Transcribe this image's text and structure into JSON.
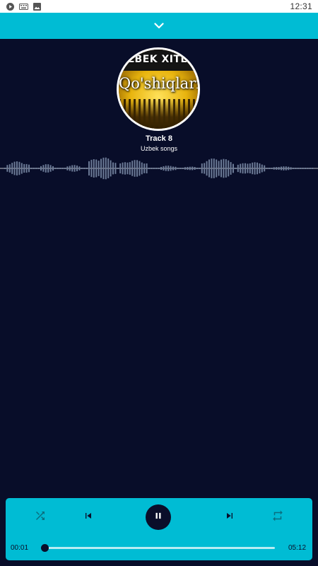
{
  "status_bar": {
    "icons": [
      "play-circle-icon",
      "keyboard-icon",
      "image-icon"
    ],
    "time": "12:31"
  },
  "top_bar": {
    "collapse_icon": "chevron-down-icon"
  },
  "album_art": {
    "banner_text": "UZBEK XITLAR",
    "title_text": "Qo'shiqlari"
  },
  "track": {
    "title": "Track 8",
    "artist": "Uzbek songs"
  },
  "visualizer": {
    "line_color": "#ffffff",
    "bar_color": "#6b7a96"
  },
  "player": {
    "elapsed": "00:01",
    "duration": "05:12",
    "progress": 0.003,
    "controls": [
      "shuffle-icon",
      "previous-icon",
      "pause-icon",
      "next-icon",
      "repeat-icon"
    ],
    "accent_color": "#00bcd4",
    "dark_color": "#0a0e2a"
  }
}
